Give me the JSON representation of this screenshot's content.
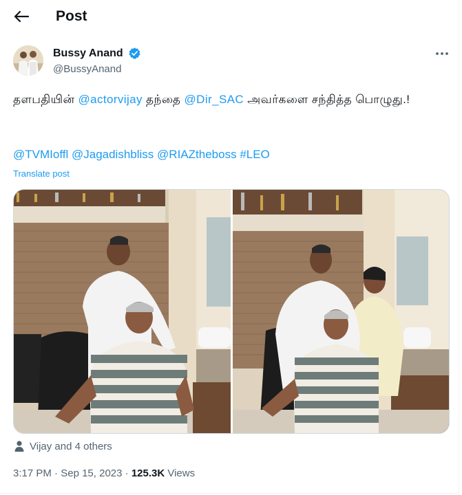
{
  "header": {
    "title": "Post"
  },
  "author": {
    "name": "Bussy Anand",
    "handle": "@BussyAnand"
  },
  "tweet": {
    "segments": [
      {
        "text": "தளபதியின் ",
        "link": false
      },
      {
        "text": "@actorvijay",
        "link": true
      },
      {
        "text": " தந்தை ",
        "link": false
      },
      {
        "text": "@Dir_SAC",
        "link": true
      },
      {
        "text": " அவர்களை சந்தித்த பொழுது.!",
        "link": false
      }
    ],
    "tags": [
      "@TVMIoffl",
      "@Jagadishbliss",
      "@RIAZtheboss",
      "#LEO"
    ],
    "translate_label": "Translate post"
  },
  "tagged": {
    "text": "Vijay and 4 others"
  },
  "meta": {
    "time": "3:17 PM",
    "separator": "·",
    "date": "Sep 15, 2023",
    "views_count": "125.3K",
    "views_label": "Views"
  },
  "colors": {
    "accent": "#1d9bf0",
    "text": "#0f1419",
    "muted": "#536471",
    "verified": "#1d9bf0"
  },
  "icons": {
    "back": "arrow-left-icon",
    "verified": "verified-badge-icon",
    "more": "more-horizontal-icon",
    "tagged": "person-icon"
  }
}
